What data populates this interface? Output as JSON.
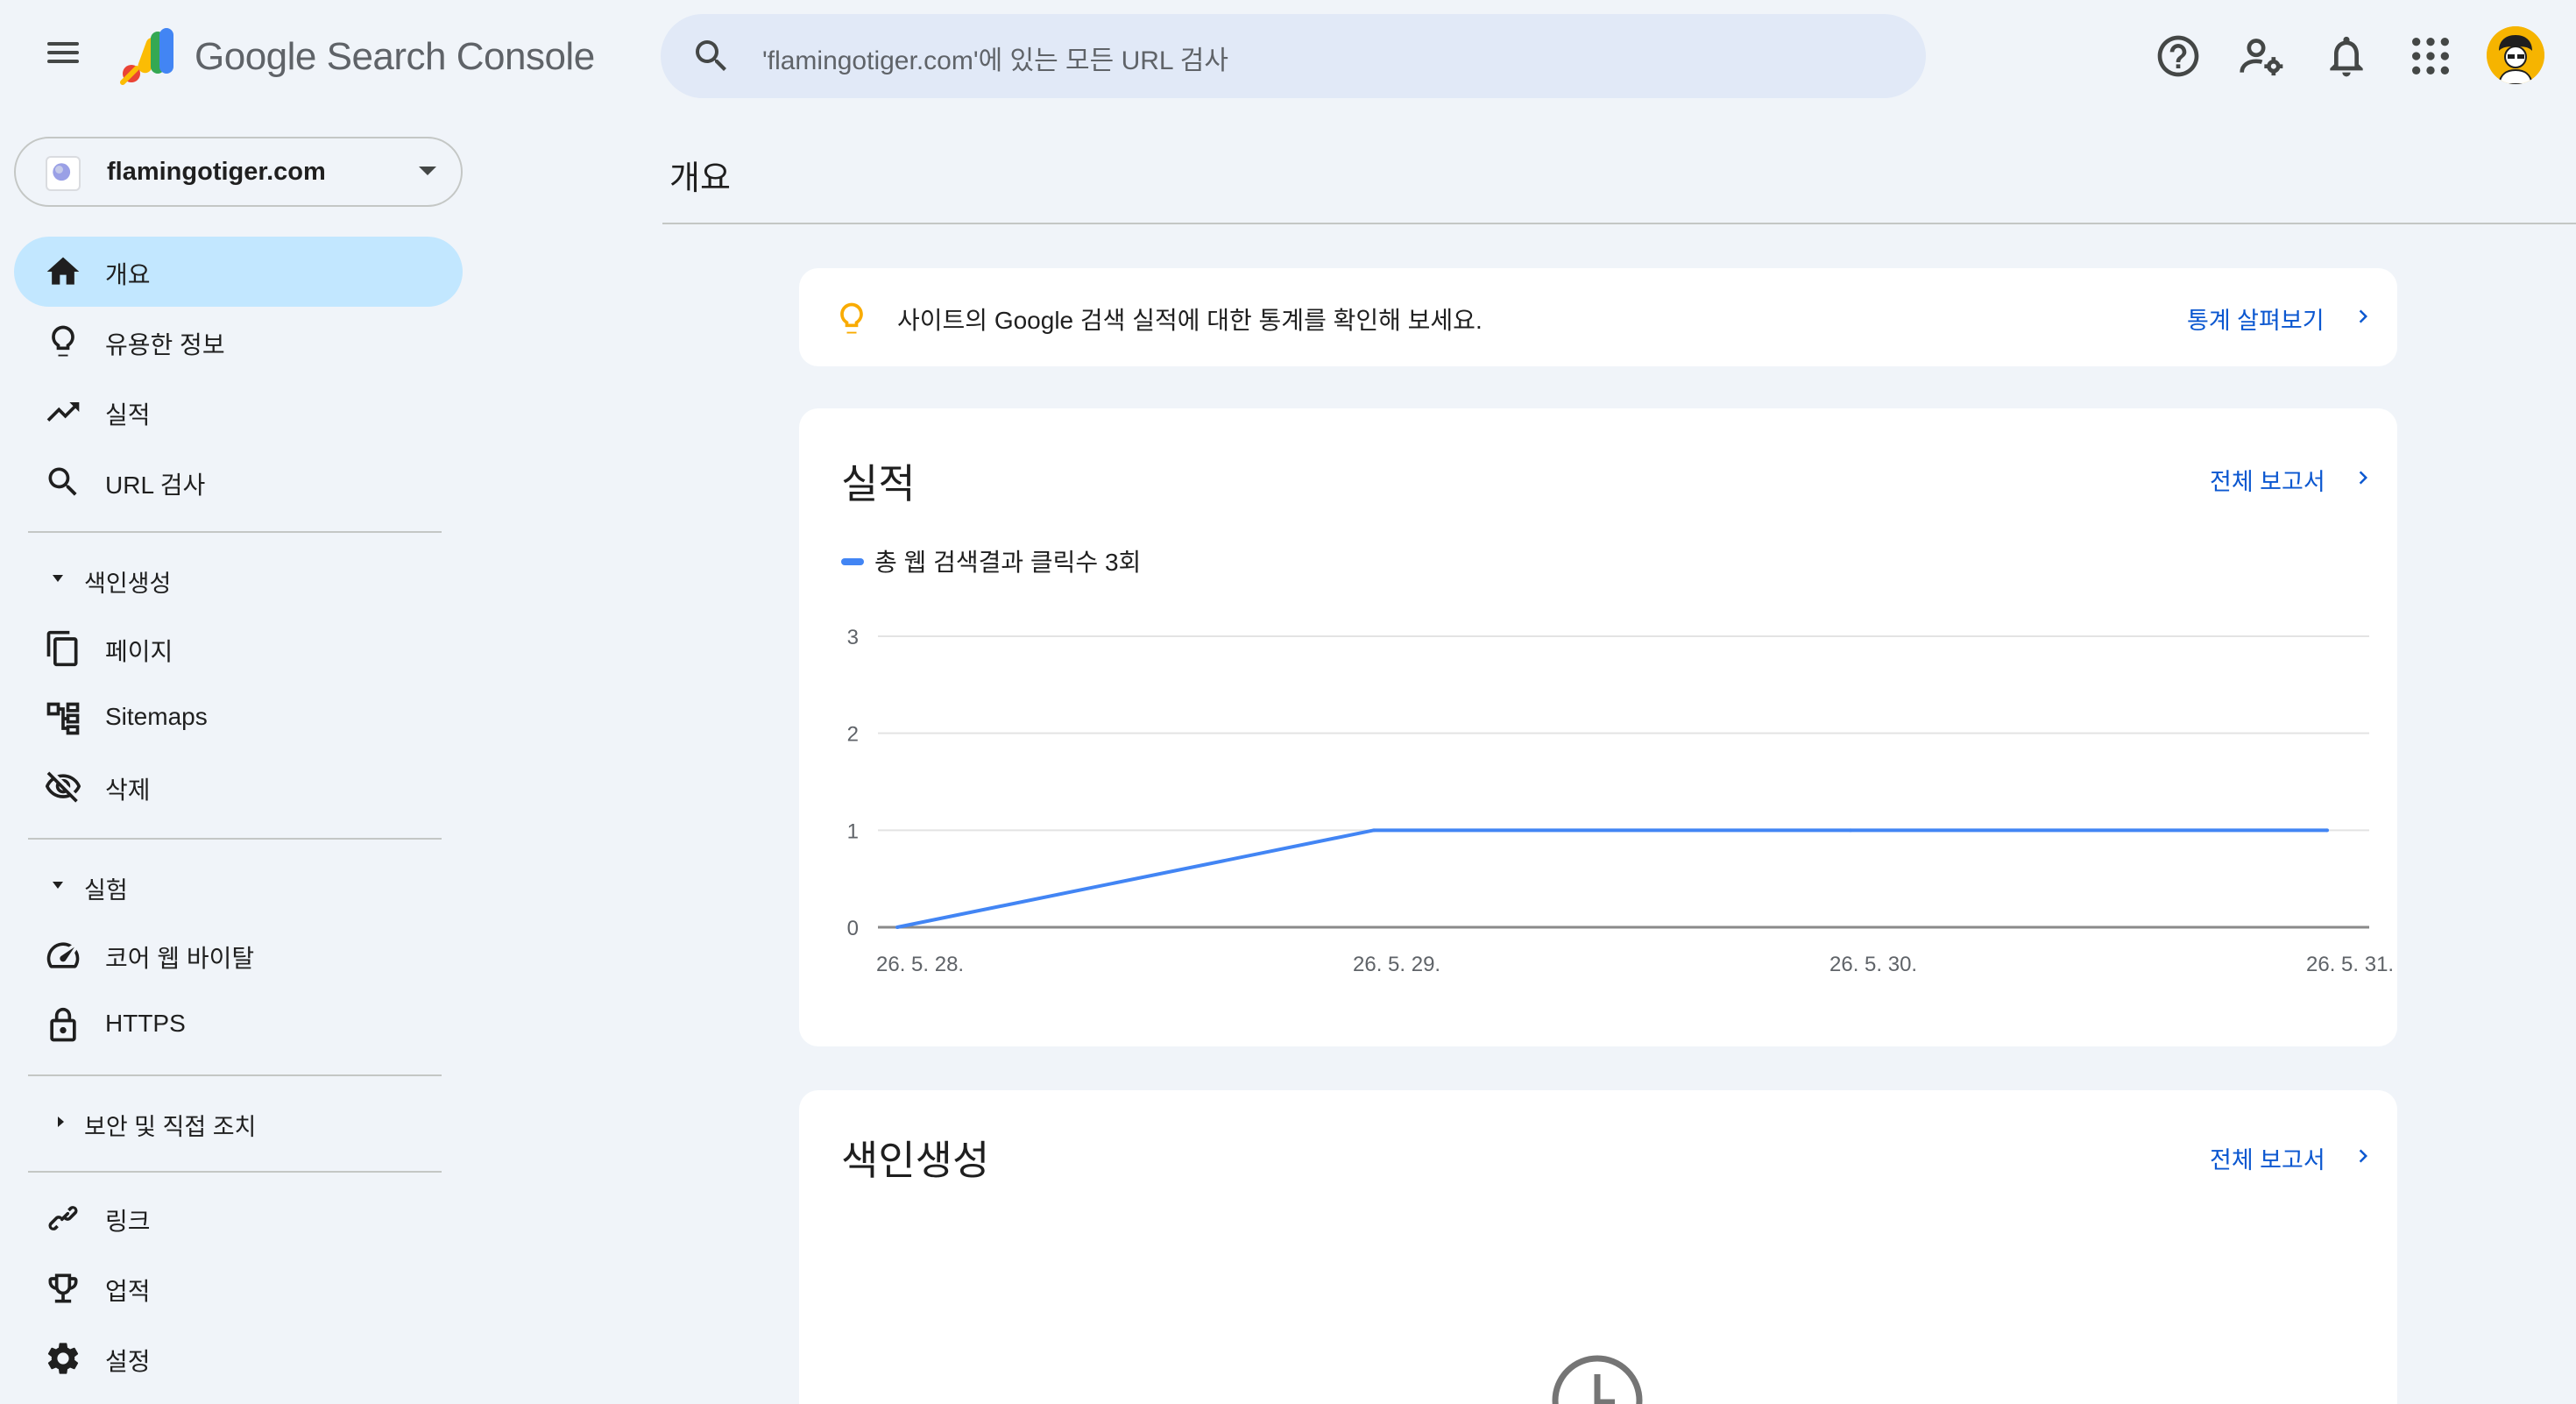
{
  "header": {
    "app_title": "Google Search Console",
    "search_placeholder": "'flamingotiger.com'에 있는 모든 URL 검사"
  },
  "property": {
    "name": "flamingotiger.com"
  },
  "sidebar": {
    "items": [
      {
        "label": "개요",
        "icon": "home-icon",
        "active": true
      },
      {
        "label": "유용한 정보",
        "icon": "lightbulb-icon"
      },
      {
        "label": "실적",
        "icon": "trending-up-icon"
      },
      {
        "label": "URL 검사",
        "icon": "search-icon"
      }
    ],
    "sections": [
      {
        "label": "색인생성",
        "expanded": true,
        "items": [
          {
            "label": "페이지",
            "icon": "pages-icon"
          },
          {
            "label": "Sitemaps",
            "icon": "sitemap-icon"
          },
          {
            "label": "삭제",
            "icon": "visibility-off-icon"
          }
        ]
      },
      {
        "label": "실험",
        "expanded": true,
        "items": [
          {
            "label": "코어 웹 바이탈",
            "icon": "speed-icon"
          },
          {
            "label": "HTTPS",
            "icon": "lock-icon"
          }
        ]
      },
      {
        "label": "보안 및 직접 조치",
        "expanded": false,
        "items": []
      }
    ],
    "bottom_items": [
      {
        "label": "링크",
        "icon": "link-icon"
      },
      {
        "label": "업적",
        "icon": "trophy-icon"
      },
      {
        "label": "설정",
        "icon": "settings-icon"
      }
    ]
  },
  "main": {
    "page_title": "개요",
    "tip": {
      "text": "사이트의 Google 검색 실적에 대한 통계를 확인해 보세요.",
      "link": "통계 살펴보기"
    },
    "performance": {
      "title": "실적",
      "link": "전체 보고서",
      "legend": "총 웹 검색결과 클릭수 3회"
    },
    "indexing": {
      "title": "색인생성",
      "link": "전체 보고서"
    }
  },
  "colors": {
    "accent": "#0b57d0",
    "series": "#4285f4",
    "active_nav": "#c2e7ff",
    "background": "#f0f4f9"
  },
  "chart_data": {
    "type": "line",
    "categories": [
      "26. 5. 28.",
      "26. 5. 29.",
      "26. 5. 30.",
      "26. 5. 31."
    ],
    "series": [
      {
        "name": "총 웹 검색결과 클릭수 3회",
        "values": [
          0,
          1,
          1,
          1
        ]
      }
    ],
    "y_ticks": [
      0,
      1,
      2,
      3
    ],
    "ylim": [
      0,
      3
    ],
    "grid": true
  }
}
